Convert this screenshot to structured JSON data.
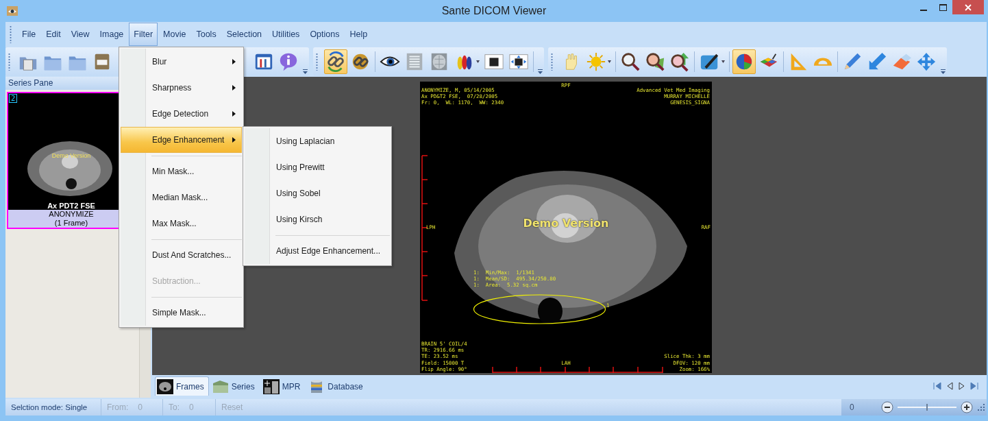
{
  "window": {
    "title": "Sante DICOM Viewer"
  },
  "menu_bar": [
    {
      "label": "File",
      "selected": false
    },
    {
      "label": "Edit",
      "selected": false
    },
    {
      "label": "View",
      "selected": false
    },
    {
      "label": "Image",
      "selected": false
    },
    {
      "label": "Filter",
      "selected": true
    },
    {
      "label": "Movie",
      "selected": false
    },
    {
      "label": "Tools",
      "selected": false
    },
    {
      "label": "Selection",
      "selected": false
    },
    {
      "label": "Utilities",
      "selected": false
    },
    {
      "label": "Options",
      "selected": false
    },
    {
      "label": "Help",
      "selected": false
    }
  ],
  "toolbar": {
    "groups": [
      {
        "buttons": [
          {
            "selected": false
          },
          {
            "selected": false
          },
          {
            "selected": false
          },
          {
            "selected": false
          },
          {
            "selected": false
          },
          {
            "selected": false
          }
        ]
      },
      {
        "buttons": [
          {
            "selected": true
          },
          {
            "selected": false
          },
          {
            "selected": false
          },
          {
            "selected": false
          },
          {
            "selected": false
          },
          {
            "selected": false
          },
          {
            "selected": false
          },
          {
            "selected": false
          }
        ]
      },
      {
        "buttons": [
          {
            "selected": false
          },
          {
            "selected": false
          },
          {
            "selected": false
          },
          {
            "selected": false
          },
          {
            "selected": false
          },
          {
            "selected": false
          },
          {
            "selected": true
          },
          {
            "selected": false
          },
          {
            "selected": false
          },
          {
            "selected": false
          },
          {
            "selected": false
          },
          {
            "selected": false
          },
          {
            "selected": false
          },
          {
            "selected": false
          }
        ]
      }
    ]
  },
  "filter_menu": {
    "items": [
      {
        "kind": "submenu",
        "label": "Blur",
        "selected": false,
        "disabled": false
      },
      {
        "kind": "submenu",
        "label": "Sharpness",
        "selected": false,
        "disabled": false
      },
      {
        "kind": "submenu",
        "label": "Edge Detection",
        "selected": false,
        "disabled": false
      },
      {
        "kind": "submenu",
        "label": "Edge Enhancement",
        "selected": true,
        "disabled": false,
        "submenu": [
          {
            "kind": "item",
            "label": "Using Laplacian",
            "selected": false,
            "disabled": false
          },
          {
            "kind": "item",
            "label": "Using Prewitt",
            "selected": false,
            "disabled": false
          },
          {
            "kind": "item",
            "label": "Using Sobel",
            "selected": false,
            "disabled": false
          },
          {
            "kind": "item",
            "label": "Using Kirsch",
            "selected": false,
            "disabled": false
          },
          {
            "kind": "separator"
          },
          {
            "kind": "item",
            "label": "Adjust Edge Enhancement...",
            "selected": false,
            "disabled": false
          }
        ]
      },
      {
        "kind": "separator"
      },
      {
        "kind": "item",
        "label": "Min Mask...",
        "selected": false,
        "disabled": false
      },
      {
        "kind": "item",
        "label": "Median Mask...",
        "selected": false,
        "disabled": false
      },
      {
        "kind": "item",
        "label": "Max Mask...",
        "selected": false,
        "disabled": false
      },
      {
        "kind": "separator"
      },
      {
        "kind": "item",
        "label": "Dust And Scratches...",
        "selected": false,
        "disabled": false
      },
      {
        "kind": "item",
        "label": "Subtraction...",
        "selected": false,
        "disabled": true
      },
      {
        "kind": "separator"
      },
      {
        "kind": "item",
        "label": "Simple Mask...",
        "selected": false,
        "disabled": false
      }
    ]
  },
  "series_pane": {
    "title": "Series Pane",
    "thumbnails": [
      {
        "number": "2",
        "overlay": "Demo Version",
        "title": "Ax PDT2 FSE",
        "patient": "ANONYMIZE",
        "frames": "(1 Frame)",
        "selected": true
      }
    ]
  },
  "viewer": {
    "top_left": [
      "ANONYMIZE, M, 05/14/2005",
      "Ax PD&T2 FSE,  07/28/2005",
      "Fr: 0,  WL: 1170,  WW: 2340"
    ],
    "top_center": "RPF",
    "top_right": [
      "Advanced Vet Med Imaging",
      "MURRAY MICHELLE",
      "GENESIS_SIGNA"
    ],
    "left": "LPH",
    "right": "RAF",
    "demo_label": "Demo Version",
    "roi": {
      "stats": [
        "1:  Min/Max:  1/1341",
        "1:  Mean/SD:  495.34/250.80",
        "1:  Area:  5.32 sq.cm"
      ],
      "label": "1"
    },
    "bottom_left": [
      "BRAIN 5' COIL/4",
      "TR: 2916.66 ms",
      "TE: 23.52 ms",
      "Field: 15000 T",
      "Flip Angle: 90°"
    ],
    "bottom_center": "LAH",
    "bottom_right": [
      "Slice Thk: 3 mm",
      "DFOV: 120 mm",
      "Zoom: 166%"
    ]
  },
  "view_tabs": [
    {
      "label": "Frames",
      "selected": true
    },
    {
      "label": "Series",
      "selected": false
    },
    {
      "label": "MPR",
      "selected": false
    },
    {
      "label": "Database",
      "selected": false
    }
  ],
  "status_bar": {
    "selection_mode": "Selction mode: Single",
    "from_label": "From:",
    "from_value": "0",
    "to_label": "To:",
    "to_value": "0",
    "reset": "Reset",
    "zoom_value": "0",
    "zoom": {
      "level": 0.5
    }
  }
}
